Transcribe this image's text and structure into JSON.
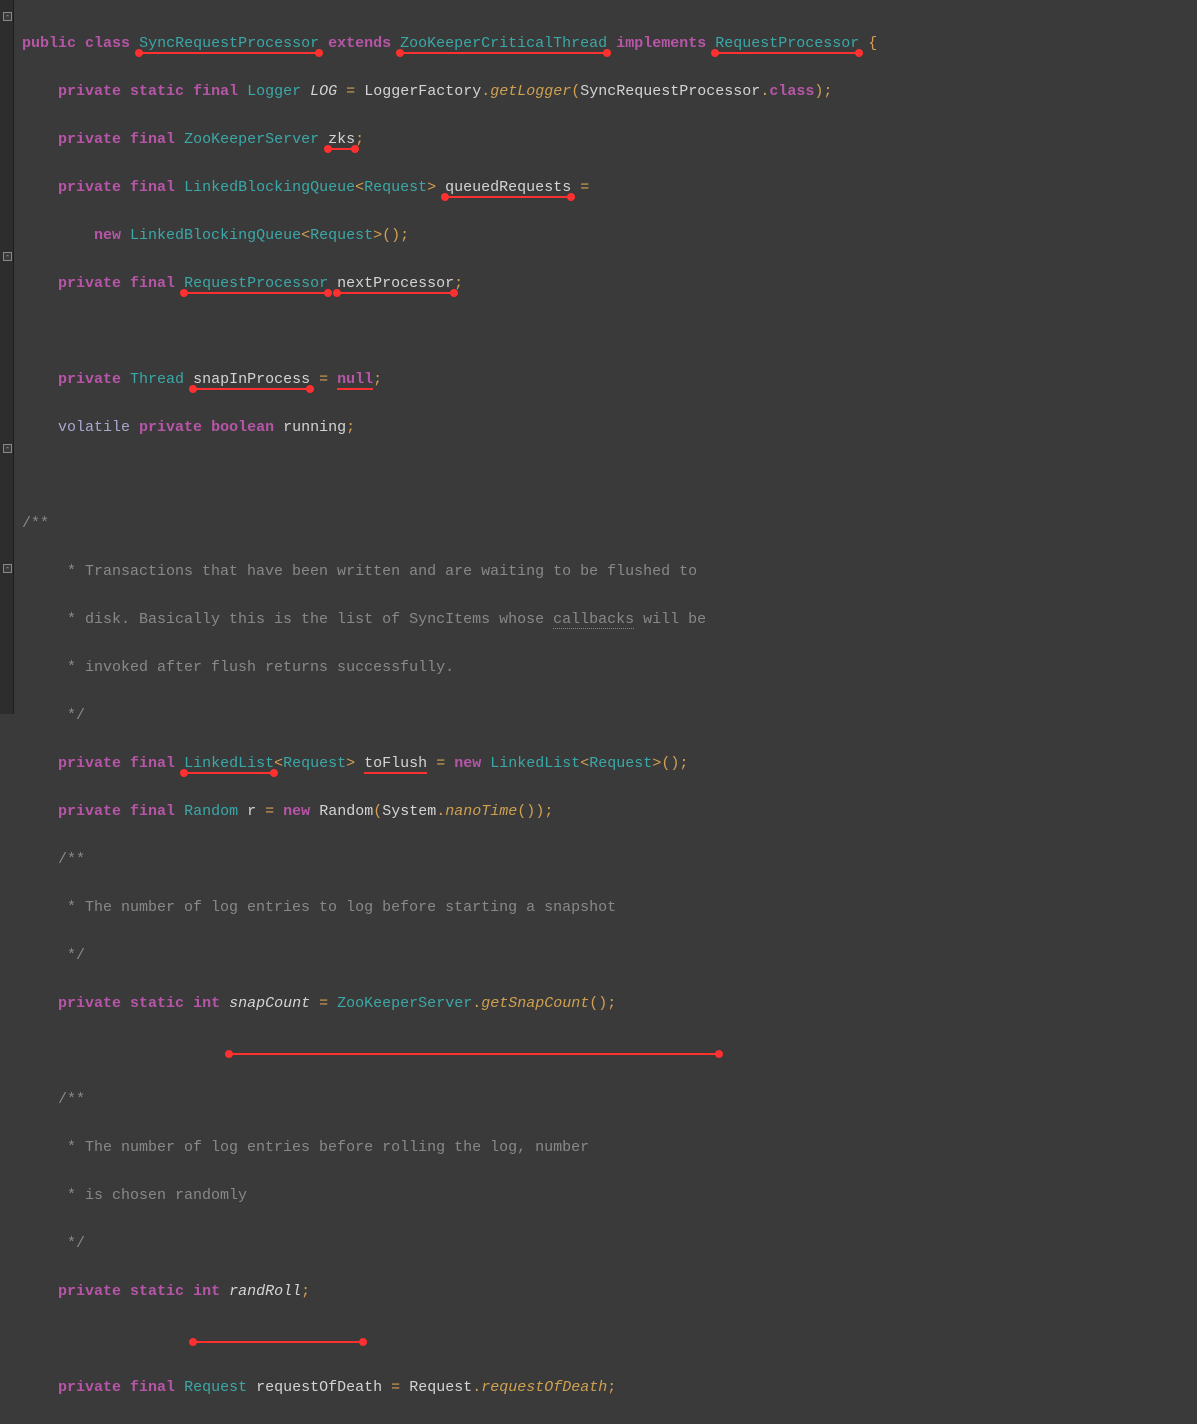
{
  "code": {
    "classDecl": {
      "public": "public",
      "class": "class",
      "name": "SyncRequestProcessor",
      "extends": "extends",
      "superclass": "ZooKeeperCriticalThread",
      "implements": "implements",
      "interface": "RequestProcessor",
      "brace": "{"
    },
    "line2": {
      "private": "private",
      "static": "static",
      "final": "final",
      "type": "Logger",
      "name": "LOG",
      "eq": "=",
      "factory": "LoggerFactory",
      "dot": ".",
      "method": "getLogger",
      "lp": "(",
      "arg": "SyncRequestProcessor",
      "dot2": ".",
      "classkw": "class",
      "rp": ")",
      "semi": ";"
    },
    "line3": {
      "private": "private",
      "final": "final",
      "type": "ZooKeeperServer",
      "name": "zks",
      "semi": ";"
    },
    "line4": {
      "private": "private",
      "final": "final",
      "type": "LinkedBlockingQueue",
      "lt": "<",
      "gen": "Request",
      "gt": ">",
      "name": "queuedRequests",
      "eq": "="
    },
    "line5": {
      "new": "new",
      "type": "LinkedBlockingQueue",
      "lt": "<",
      "gen": "Request",
      "gt": ">",
      "lp": "(",
      "rp": ")",
      "semi": ";"
    },
    "line6": {
      "private": "private",
      "final": "final",
      "type": "RequestProcessor",
      "name": "nextProcessor",
      "semi": ";"
    },
    "line8": {
      "private": "private",
      "type": "Thread",
      "name": "snapInProcess",
      "eq": "=",
      "null": "null",
      "semi": ";"
    },
    "line9": {
      "volatile": "volatile",
      "private": "private",
      "boolean": "boolean",
      "name": "running",
      "semi": ";"
    },
    "comment1_l1": "/**",
    "comment1_l2": " * Transactions that have been written and are waiting to be flushed to",
    "comment1_l3a": " * disk. Basically this is the list of SyncItems whose ",
    "comment1_l3b": "callbacks",
    "comment1_l3c": " will be",
    "comment1_l4": " * invoked after flush returns successfully.",
    "comment1_l5": " */",
    "line15": {
      "private": "private",
      "final": "final",
      "type": "LinkedList",
      "lt": "<",
      "gen": "Request",
      "gt": ">",
      "name": "toFlush",
      "eq": "=",
      "new": "new",
      "type2": "LinkedList",
      "lt2": "<",
      "gen2": "Request",
      "gt2": ">",
      "lp": "(",
      "rp": ")",
      "semi": ";"
    },
    "line16": {
      "private": "private",
      "final": "final",
      "type": "Random",
      "name": "r",
      "eq": "=",
      "new": "new",
      "ctor": "Random",
      "lp": "(",
      "sys": "System",
      "dot": ".",
      "method": "nanoTime",
      "lp2": "(",
      "rp2": ")",
      "rp": ")",
      "semi": ";"
    },
    "comment2_l1": "/**",
    "comment2_l2": " * The number of log entries to log before starting a snapshot",
    "comment2_l3": " */",
    "line20": {
      "private": "private",
      "static": "static",
      "int": "int",
      "name": "snapCount",
      "eq": "=",
      "cls": "ZooKeeperServer",
      "dot": ".",
      "method": "getSnapCount",
      "lp": "(",
      "rp": ")",
      "semi": ";"
    },
    "comment3_l1": "/**",
    "comment3_l2": " * The number of log entries before rolling the log, number",
    "comment3_l3": " * is chosen randomly",
    "comment3_l4": " */",
    "line25": {
      "private": "private",
      "static": "static",
      "int": "int",
      "name": "randRoll",
      "semi": ";"
    },
    "line27": {
      "private": "private",
      "final": "final",
      "type": "Request",
      "name": "requestOfDeath",
      "eq": "=",
      "cls": "Request",
      "dot": ".",
      "field": "requestOfDeath",
      "semi": ";"
    }
  }
}
